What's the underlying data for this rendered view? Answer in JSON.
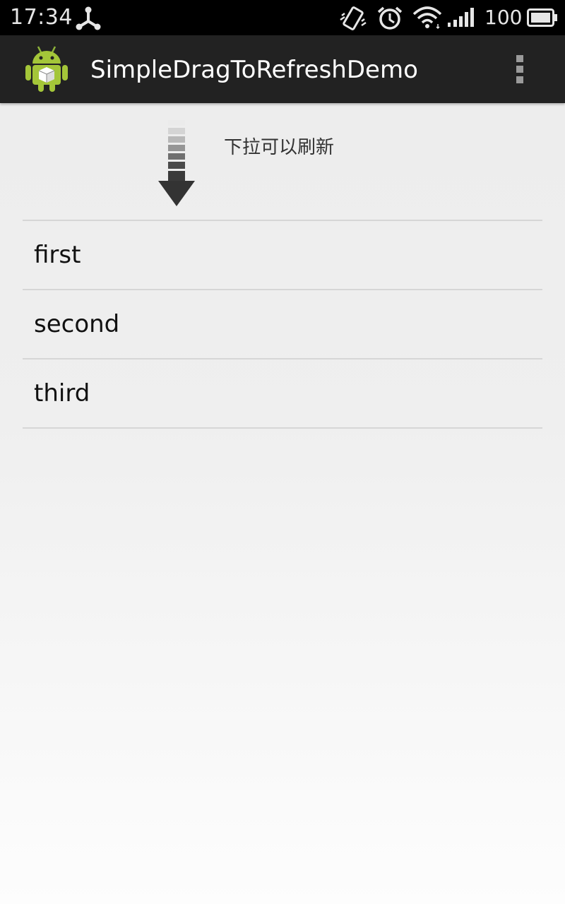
{
  "status_bar": {
    "time": "17:34",
    "battery_level": "100",
    "icons": [
      "usb-icon",
      "vibrate-icon",
      "alarm-icon",
      "wifi-icon",
      "signal-icon",
      "battery-icon"
    ]
  },
  "action_bar": {
    "app_icon": "android-icon",
    "title": "SimpleDragToRefreshDemo",
    "overflow_icon": "overflow-menu-icon"
  },
  "pull_header": {
    "arrow_icon": "pull-down-arrow-icon",
    "text": "下拉可以刷新"
  },
  "list": {
    "items": [
      "first",
      "second",
      "third"
    ]
  },
  "colors": {
    "status_bar_bg": "#000000",
    "action_bar_bg": "#222222",
    "android_green": "#a4c639",
    "divider": "#d6d6d6"
  }
}
